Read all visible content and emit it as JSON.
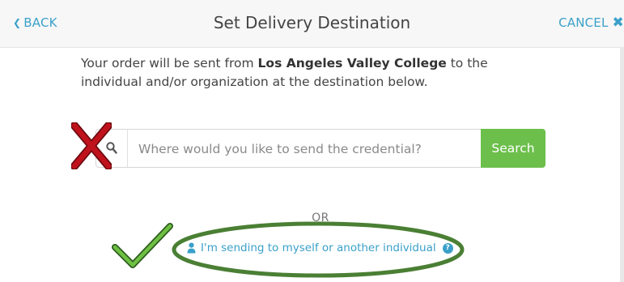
{
  "header": {
    "back_label": "BACK",
    "title": "Set Delivery Destination",
    "cancel_label": "CANCEL"
  },
  "intro": {
    "text_before": "Your order will be sent from ",
    "institution": "Los Angeles Valley College",
    "text_after": " to the individual and/or organization at the destination below."
  },
  "search": {
    "placeholder": "Where would you like to send the credential?",
    "button_label": "Search"
  },
  "divider_label": "OR",
  "individual_link": {
    "label": "I'm sending to myself or another individual",
    "help_icon": "?"
  },
  "annotations": {
    "cross_mark_color": "#c0121c",
    "check_mark_color": "#4f9a36",
    "highlight_ellipse_color": "#4a7f34"
  },
  "colors": {
    "accent": "#3aa0c9",
    "search_button": "#6cbf4b",
    "header_bg": "#f7f7f7"
  },
  "icons": {
    "back": "chevron-left-icon",
    "cancel": "close-icon",
    "search": "search-icon",
    "person": "person-icon",
    "help": "help-icon"
  }
}
